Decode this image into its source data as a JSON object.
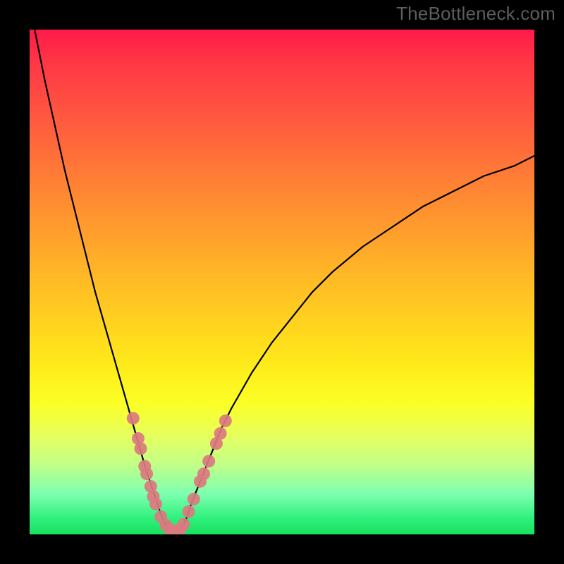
{
  "watermark": "TheBottleneck.com",
  "colors": {
    "frame_bg": "#000000",
    "gradient_top": "#ff1a4a",
    "gradient_bottom": "#1ae060",
    "curve": "#000000",
    "marker_fill": "#db7a7f",
    "marker_stroke": "#9c4a4e"
  },
  "chart_data": {
    "type": "line",
    "title": "",
    "xlabel": "",
    "ylabel": "",
    "xlim": [
      0,
      100
    ],
    "ylim": [
      0,
      100
    ],
    "series": [
      {
        "name": "bottleneck-curve",
        "x": [
          1,
          3,
          5,
          7,
          9,
          11,
          13,
          15,
          17,
          19,
          21,
          23,
          24,
          25,
          26,
          27,
          28,
          29,
          30,
          31,
          32,
          34,
          36,
          38,
          40,
          44,
          48,
          52,
          56,
          60,
          66,
          72,
          78,
          84,
          90,
          96,
          100
        ],
        "y": [
          100,
          90,
          81,
          72,
          64,
          56,
          48,
          41,
          34,
          27,
          20,
          13,
          10,
          7,
          4,
          2,
          1,
          0.5,
          1,
          3,
          6,
          11,
          16,
          21,
          25,
          32,
          38,
          43,
          48,
          52,
          57,
          61,
          65,
          68,
          71,
          73,
          75
        ]
      }
    ],
    "markers": {
      "name": "gpu-points",
      "points": [
        {
          "x": 20.5,
          "y": 23
        },
        {
          "x": 21.5,
          "y": 19
        },
        {
          "x": 22,
          "y": 17
        },
        {
          "x": 22.8,
          "y": 13.5
        },
        {
          "x": 23.2,
          "y": 12
        },
        {
          "x": 24,
          "y": 9.5
        },
        {
          "x": 24.5,
          "y": 7.5
        },
        {
          "x": 25,
          "y": 6
        },
        {
          "x": 26,
          "y": 3.5
        },
        {
          "x": 27,
          "y": 1.8
        },
        {
          "x": 27.8,
          "y": 1
        },
        {
          "x": 28.5,
          "y": 0.6
        },
        {
          "x": 29,
          "y": 0.5
        },
        {
          "x": 29.8,
          "y": 1
        },
        {
          "x": 30.5,
          "y": 2
        },
        {
          "x": 31.5,
          "y": 4.5
        },
        {
          "x": 32.5,
          "y": 7
        },
        {
          "x": 33.8,
          "y": 10.5
        },
        {
          "x": 34.5,
          "y": 12
        },
        {
          "x": 35.5,
          "y": 14.5
        },
        {
          "x": 37,
          "y": 18
        },
        {
          "x": 37.8,
          "y": 20
        },
        {
          "x": 38.8,
          "y": 22.5
        }
      ]
    }
  }
}
